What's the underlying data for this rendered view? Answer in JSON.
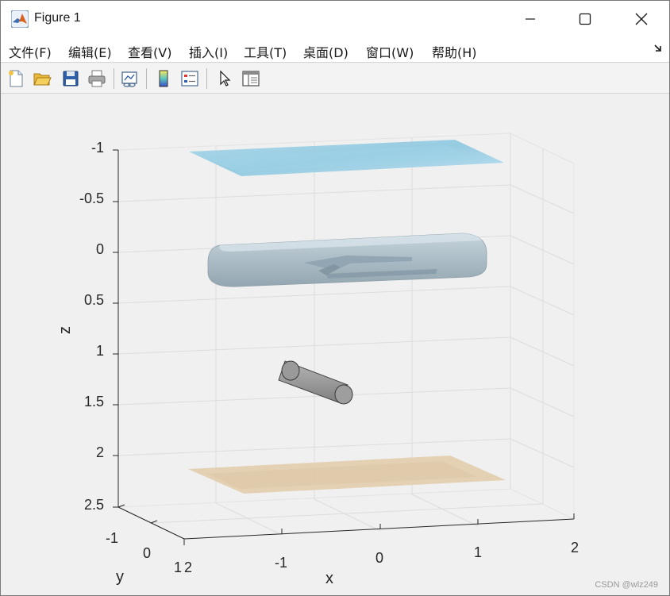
{
  "window": {
    "title": "Figure 1",
    "controls": {
      "minimize": "minimize-icon",
      "maximize": "maximize-icon",
      "close": "close-icon"
    }
  },
  "menubar": {
    "items": [
      {
        "label": "文件(F)"
      },
      {
        "label": "编辑(E)"
      },
      {
        "label": "查看(V)"
      },
      {
        "label": "插入(I)"
      },
      {
        "label": "工具(T)"
      },
      {
        "label": "桌面(D)"
      },
      {
        "label": "窗口(W)"
      },
      {
        "label": "帮助(H)"
      }
    ]
  },
  "toolbar": {
    "buttons": [
      {
        "icon": "new-figure-icon"
      },
      {
        "icon": "open-file-icon"
      },
      {
        "icon": "save-icon"
      },
      {
        "icon": "print-icon"
      },
      {
        "icon": "link-plot-icon"
      },
      {
        "icon": "insert-colorbar-icon"
      },
      {
        "icon": "insert-legend-icon"
      },
      {
        "icon": "edit-plot-pointer-icon"
      },
      {
        "icon": "property-inspector-icon"
      }
    ]
  },
  "axes": {
    "xlabel": "x",
    "ylabel": "y",
    "zlabel": "z",
    "x_ticks": [
      "-1",
      "0",
      "1",
      "2"
    ],
    "y_ticks": [
      "-1",
      "0",
      "1",
      "2"
    ],
    "z_ticks": [
      "-1",
      "-0.5",
      "0",
      "0.5",
      "1",
      "1.5",
      "2",
      "2.5"
    ],
    "z_direction": "reversed",
    "grid": true
  },
  "objects": [
    {
      "name": "water-surface-plane",
      "color": "#8fcbe2"
    },
    {
      "name": "vehicle-hull",
      "color": "#a9bcc6"
    },
    {
      "name": "cylinder",
      "color": "#9b9b9b"
    },
    {
      "name": "seabed-plane",
      "color": "#e3cfb0"
    }
  ],
  "watermark": "CSDN @wlz249"
}
